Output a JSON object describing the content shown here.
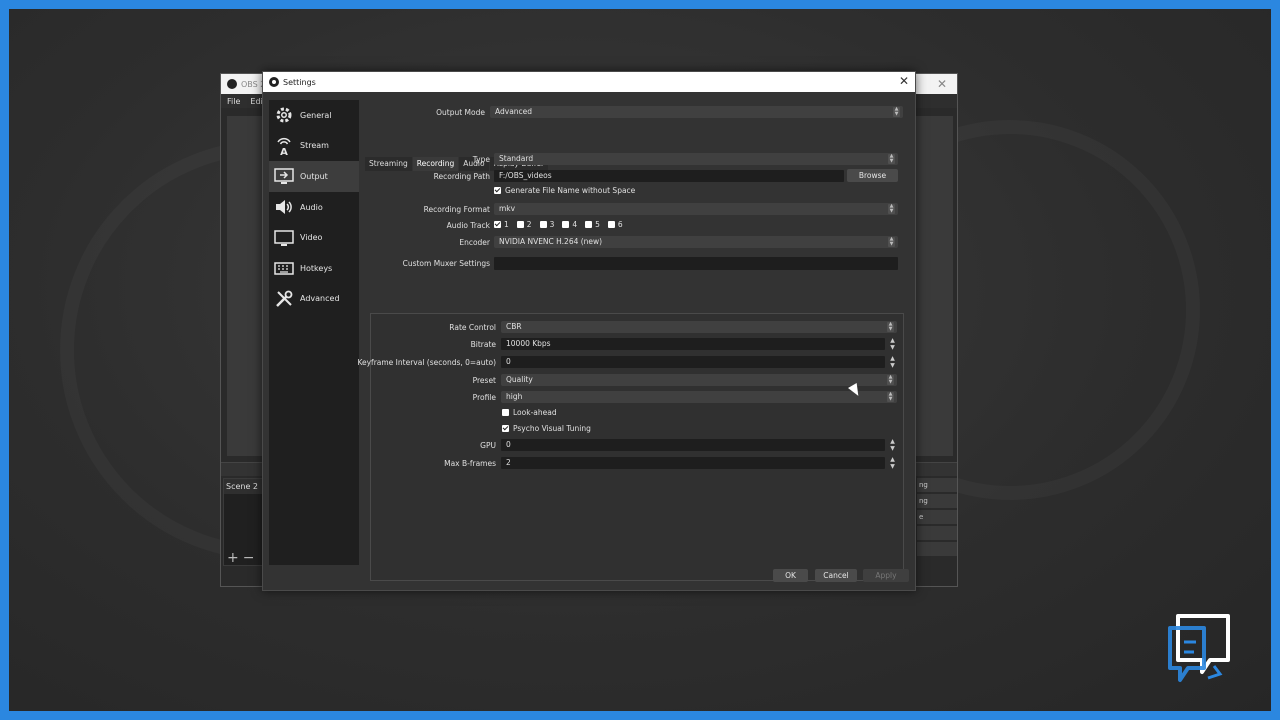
{
  "obs_main": {
    "title": "OBS 2",
    "menu": [
      "File",
      "Edit"
    ],
    "scene": "Scene 2",
    "scene_add": "+",
    "scene_remove": "−",
    "right_dock_items": [
      "ng",
      "ng",
      "e",
      "",
      ""
    ]
  },
  "settings": {
    "title": "Settings",
    "close": "✕",
    "sidebar": [
      {
        "label": "General",
        "icon": "gear-icon"
      },
      {
        "label": "Stream",
        "icon": "antenna-icon"
      },
      {
        "label": "Output",
        "icon": "monitor-output-icon",
        "active": true
      },
      {
        "label": "Audio",
        "icon": "speaker-icon"
      },
      {
        "label": "Video",
        "icon": "monitor-icon"
      },
      {
        "label": "Hotkeys",
        "icon": "keyboard-icon"
      },
      {
        "label": "Advanced",
        "icon": "tools-icon"
      }
    ],
    "output_mode": {
      "label": "Output Mode",
      "value": "Advanced"
    },
    "tabs": [
      "Streaming",
      "Recording",
      "Audio",
      "Replay Buffer"
    ],
    "active_tab": "Recording",
    "recording": {
      "type": {
        "label": "Type",
        "value": "Standard"
      },
      "path": {
        "label": "Recording Path",
        "value": "F:/OBS_videos",
        "browse": "Browse"
      },
      "gen_filename": {
        "label": "Generate File Name without Space",
        "checked": true
      },
      "format": {
        "label": "Recording Format",
        "value": "mkv"
      },
      "audio_track": {
        "label": "Audio Track",
        "tracks": [
          {
            "n": "1",
            "checked": true
          },
          {
            "n": "2",
            "checked": false
          },
          {
            "n": "3",
            "checked": false
          },
          {
            "n": "4",
            "checked": false
          },
          {
            "n": "5",
            "checked": false
          },
          {
            "n": "6",
            "checked": false
          }
        ]
      },
      "encoder": {
        "label": "Encoder",
        "value": "NVIDIA NVENC H.264 (new)"
      },
      "muxer": {
        "label": "Custom Muxer Settings",
        "value": ""
      }
    },
    "encoder_settings": {
      "rate_control": {
        "label": "Rate Control",
        "value": "CBR"
      },
      "bitrate": {
        "label": "Bitrate",
        "value": "10000 Kbps"
      },
      "keyframe": {
        "label": "Keyframe Interval (seconds, 0=auto)",
        "value": "0"
      },
      "preset": {
        "label": "Preset",
        "value": "Quality"
      },
      "profile": {
        "label": "Profile",
        "value": "high"
      },
      "lookahead": {
        "label": "Look-ahead",
        "checked": false
      },
      "psycho": {
        "label": "Psycho Visual Tuning",
        "checked": true
      },
      "gpu": {
        "label": "GPU",
        "value": "0"
      },
      "bframes": {
        "label": "Max B-frames",
        "value": "2"
      }
    },
    "buttons": {
      "ok": "OK",
      "cancel": "Cancel",
      "apply": "Apply"
    }
  },
  "colors": {
    "frame": "#2b87e0",
    "dialog_bg": "#333333",
    "sidebar_bg": "#1f1f1f"
  }
}
